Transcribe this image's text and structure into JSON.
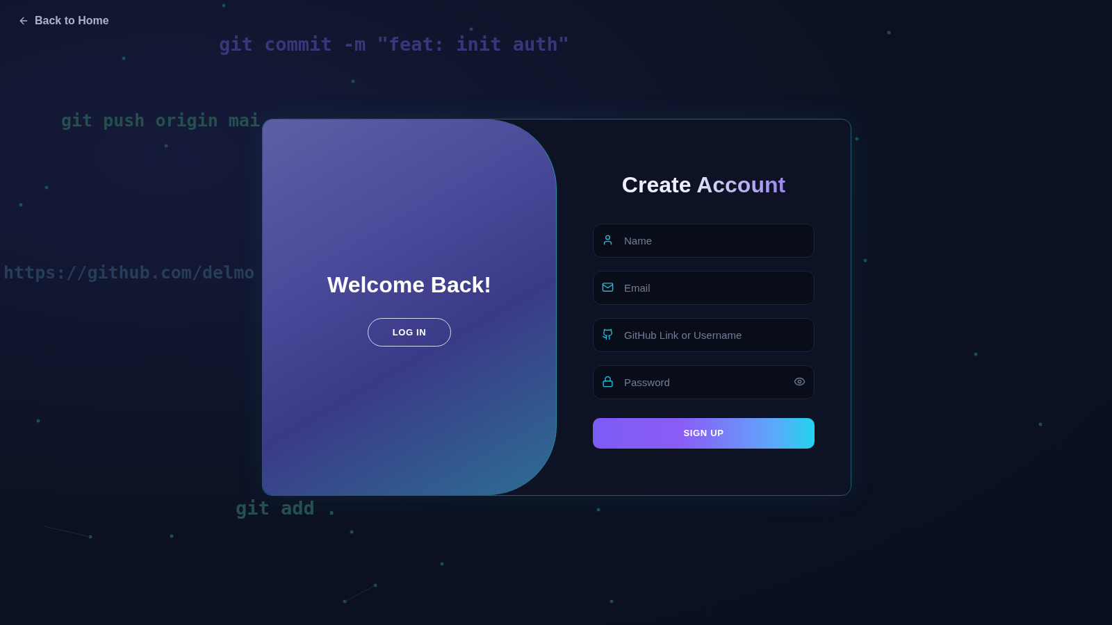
{
  "back_link": "Back to Home",
  "background_code": [
    {
      "text": "git commit -m \"feat: init auth\"",
      "color": "#36387a"
    },
    {
      "text": "git push origin mai",
      "color": "#26504f"
    },
    {
      "text": "https://github.com/delmo",
      "color": "#283c5c"
    },
    {
      "text": "git add .",
      "color": "#26504f"
    }
  ],
  "welcome": {
    "heading": "Welcome Back!",
    "button": "LOG IN"
  },
  "signup": {
    "title": "Create",
    "title_accent": "Account",
    "fields": [
      {
        "kind": "name",
        "placeholder": "Name"
      },
      {
        "kind": "email",
        "placeholder": "Email"
      },
      {
        "kind": "github",
        "placeholder": "GitHub Link or Username"
      },
      {
        "kind": "password",
        "placeholder": "Password"
      }
    ],
    "button": "SIGN UP"
  }
}
